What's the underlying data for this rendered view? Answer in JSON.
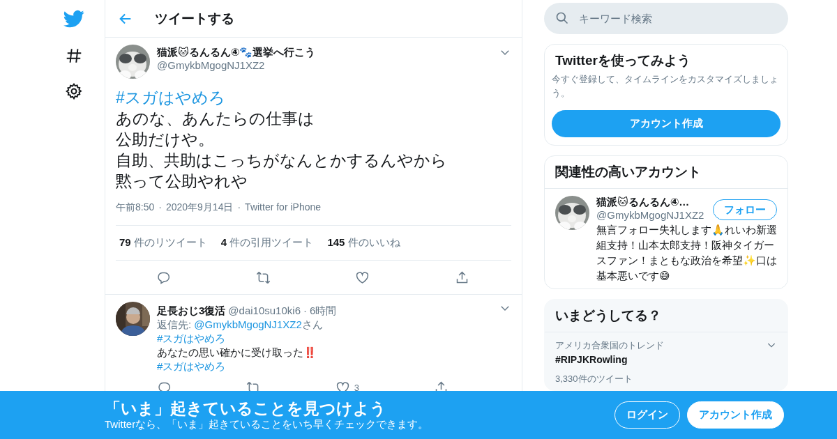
{
  "header": {
    "title": "ツイートする"
  },
  "tweet": {
    "name": "猫派🐱るんるん④🐾選挙へ行こう",
    "handle": "@GmykbMgogNJ1XZ2",
    "hashtag": "#スガはやめろ",
    "lines": [
      "あのな、あんたらの仕事は",
      "公助だけや。",
      "自助、共助はこっちがなんとかするんやから",
      "黙って公助やれや"
    ],
    "time": "午前8:50",
    "separator": "·",
    "date": "2020年9月14日",
    "separator_2": "·",
    "source": "Twitter for iPhone",
    "stats": [
      {
        "count": "79",
        "label": "件のリツイート"
      },
      {
        "count": "4",
        "label": "件の引用ツイート"
      },
      {
        "count": "145",
        "label": "件のいいね"
      }
    ]
  },
  "reply": {
    "name": "足長おじ3復活",
    "handle": "@dai10su10ki6",
    "separator": "·",
    "time": "6時間",
    "reply_prefix": "返信先: ",
    "reply_to": "@GmykbMgogNJ1XZ2",
    "reply_suffix": "さん",
    "like_count": "3",
    "lines": [
      {
        "kind": "hashtag",
        "text": "#スガはやめろ"
      },
      {
        "kind": "text",
        "text": "あなたの思い確かに受け取った‼️"
      },
      {
        "kind": "hashtag",
        "text": "#スガはやめろ"
      }
    ]
  },
  "search": {
    "placeholder": "キーワード検索"
  },
  "signup_card": {
    "title": "Twitterを使ってみよう",
    "description": "今すぐ登録して、タイムラインをカスタマイズしましょう。",
    "button": "アカウント作成"
  },
  "who_to_follow": {
    "title": "関連性の高いアカウント",
    "accounts": [
      {
        "name": "猫派🐱るんるん④…",
        "handle": "@GmykbMgogNJ1XZ2",
        "bio": "無言フォロー失礼します🙏れいわ新選組支持！山本太郎支持！阪神タイガースファン！まともな政治を希望✨口は基本悪いです😅",
        "button": "フォロー"
      }
    ]
  },
  "trends": {
    "title": "いまどうしてる？",
    "items": [
      {
        "context": "アメリカ合衆国のトレンド",
        "name": "#RIPJKRowling",
        "count": "3,330件のツイート"
      }
    ]
  },
  "banner": {
    "title": "「いま」起きていることを見つけよう",
    "subtitle": "Twitterなら、「いま」起きていることをいち早くチェックできます。",
    "buttons": [
      {
        "label": "ログイン",
        "kind": "outline"
      },
      {
        "label": "アカウント作成",
        "kind": "solid"
      }
    ]
  }
}
